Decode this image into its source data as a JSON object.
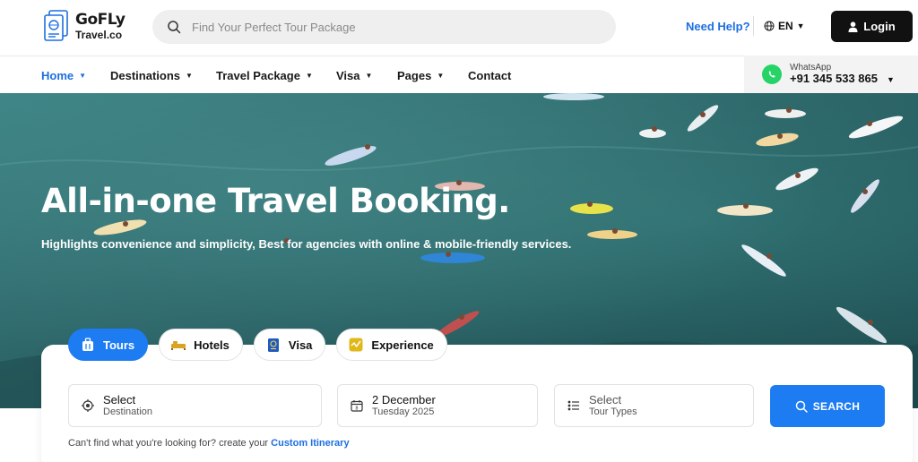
{
  "brand": {
    "name": "GoFLy",
    "sub": "Travel.co"
  },
  "search": {
    "placeholder": "Find Your Perfect Tour Package"
  },
  "header": {
    "need_help": "Need Help?",
    "language": "EN",
    "login": "Login"
  },
  "nav": {
    "items": [
      {
        "label": "Home",
        "active": true
      },
      {
        "label": "Destinations"
      },
      {
        "label": "Travel Package"
      },
      {
        "label": "Visa"
      },
      {
        "label": "Pages"
      },
      {
        "label": "Contact"
      }
    ]
  },
  "whatsapp": {
    "label": "WhatsApp",
    "number": "+91 345 533 865"
  },
  "hero": {
    "title": "All-in-one Travel Booking.",
    "subtitle": "Highlights convenience and simplicity, Best for agencies with online & mobile-friendly services."
  },
  "tabs": [
    {
      "label": "Tours",
      "icon": "luggage-icon",
      "active": true
    },
    {
      "label": "Hotels",
      "icon": "bed-icon"
    },
    {
      "label": "Visa",
      "icon": "passport-icon"
    },
    {
      "label": "Experience",
      "icon": "activity-icon"
    }
  ],
  "fields": {
    "destination": {
      "main": "Select",
      "sub": "Destination",
      "icon": "location-target-icon"
    },
    "date": {
      "main": "2 December",
      "sub": "Tuesday 2025",
      "icon": "calendar-icon"
    },
    "tour_type": {
      "main": "Select",
      "sub": "Tour Types",
      "icon": "list-icon"
    }
  },
  "search_button": "SEARCH",
  "hint": {
    "text": "Can't find what you're looking for? create your ",
    "link": "Custom Itinerary"
  },
  "colors": {
    "accent": "#1d7cf2",
    "link": "#1d6fe0",
    "dark": "#111111",
    "whatsapp": "#25d366"
  }
}
